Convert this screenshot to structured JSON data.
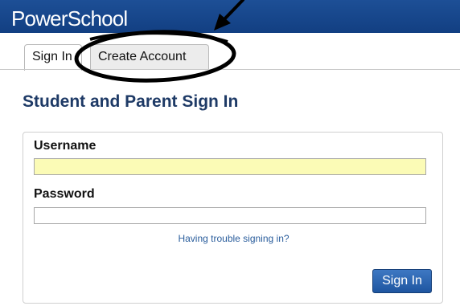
{
  "header": {
    "logo_text": "PowerSchool",
    "brand_color": "#174690"
  },
  "tabs": [
    {
      "label": "Sign In",
      "selected": true
    },
    {
      "label": "Create Account",
      "selected": false
    }
  ],
  "page": {
    "title": "Student and Parent Sign In"
  },
  "form": {
    "username_label": "Username",
    "username_value": "",
    "password_label": "Password",
    "password_value": "",
    "help_link": "Having trouble signing in?",
    "submit_label": "Sign In"
  },
  "annotation": {
    "type": "hand-drawn circle and arrow highlighting Create Account tab",
    "color": "#000000"
  }
}
